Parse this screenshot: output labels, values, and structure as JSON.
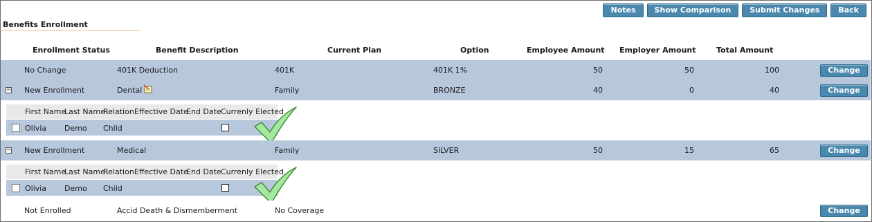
{
  "toolbar": {
    "notes_label": "Notes",
    "show_comparison_label": "Show Comparison",
    "submit_changes_label": "Submit Changes",
    "back_label": "Back"
  },
  "page_title": "Benefits Enrollment",
  "columns": {
    "status": "Enrollment Status",
    "description": "Benefit Description",
    "plan": "Current Plan",
    "option": "Option",
    "employee": "Employee Amount",
    "employer": "Employer Amount",
    "total": "Total Amount"
  },
  "change_label": "Change",
  "rows": [
    {
      "status": "No Change",
      "description": "401K Deduction",
      "plan": "401K",
      "option": "401K 1%",
      "employee": "50",
      "employer": "50",
      "total": "100"
    },
    {
      "status": "New Enrollment",
      "description": "Dental",
      "plan": "Family",
      "option": "BRONZE",
      "employee": "40",
      "employer": "0",
      "total": "40"
    },
    {
      "status": "New Enrollment",
      "description": "Medical",
      "plan": "Family",
      "option": "SILVER",
      "employee": "50",
      "employer": "15",
      "total": "65"
    },
    {
      "status": "Not Enrolled",
      "description": "Accid Death & Dismemberment",
      "plan": "No Coverage",
      "option": "",
      "employee": "",
      "employer": "",
      "total": ""
    }
  ],
  "dependent_columns": {
    "first_name": "First Name",
    "last_name": "Last Name",
    "relation": "Relation",
    "effective_date": "Effective Date",
    "end_date": "End Date",
    "currently_elected": "Currenly Elected"
  },
  "dependents": {
    "dental": {
      "first_name": "Olivia",
      "last_name": "Demo",
      "relation": "Child"
    },
    "medical": {
      "first_name": "Olivia",
      "last_name": "Demo",
      "relation": "Child"
    }
  },
  "expander_symbol": "−",
  "colors": {
    "button": "#4a88ad",
    "row": "#b7c7dc",
    "subheader": "#e9e9e9",
    "check": "#9fe49a"
  },
  "icons": [
    "notes-icon",
    "checkmark-icon",
    "collapse-icon",
    "checkbox"
  ]
}
